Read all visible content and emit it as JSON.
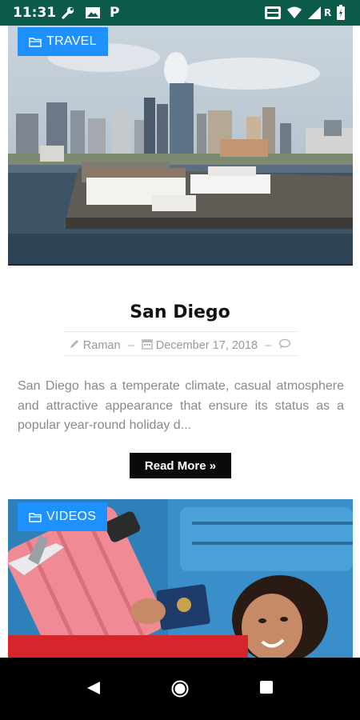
{
  "status_bar": {
    "time": "11:31",
    "icons": [
      "wrench-icon",
      "photo-icon",
      "p-icon",
      "vowifi-icon",
      "wifi-icon",
      "signal-icon",
      "r-icon",
      "battery-icon"
    ],
    "roaming_label": "R",
    "p_label": "P",
    "background": "#0b5a4a"
  },
  "posts": [
    {
      "category": "TRAVEL",
      "category_icon": "folder-icon",
      "title": "San Diego",
      "author": "Raman",
      "date": "December 17, 2018",
      "excerpt": "San Diego has a temperate climate, casual atmosphere and attractive appearance that ensure its status as a popular year-round holiday d...",
      "read_more": "Read More »"
    },
    {
      "category": "VIDEOS",
      "category_icon": "folder-icon"
    }
  ],
  "nav_bar": {
    "buttons": [
      "back-icon",
      "home-icon",
      "recents-icon"
    ]
  },
  "colors": {
    "accent": "#1e90ff",
    "button": "#0a0a0a"
  }
}
